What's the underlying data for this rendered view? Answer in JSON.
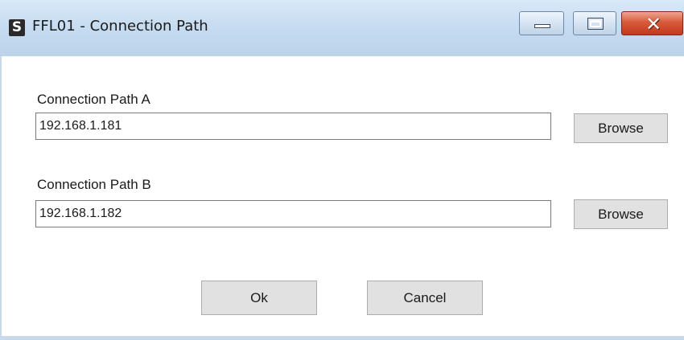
{
  "window": {
    "app_icon_glyph": "S",
    "title": "FFL01 - Connection Path",
    "caption_buttons": {
      "minimize_icon": "minimize-icon",
      "maximize_icon": "maximize-icon",
      "close_icon": "close-icon",
      "close_glyph": "✕",
      "close_color": "#d0492b"
    }
  },
  "form": {
    "path_a": {
      "label": "Connection Path A",
      "value": "192.168.1.181",
      "browse_label": "Browse"
    },
    "path_b": {
      "label": "Connection Path B",
      "value": "192.168.1.182",
      "browse_label": "Browse"
    }
  },
  "footer": {
    "ok_label": "Ok",
    "cancel_label": "Cancel"
  }
}
